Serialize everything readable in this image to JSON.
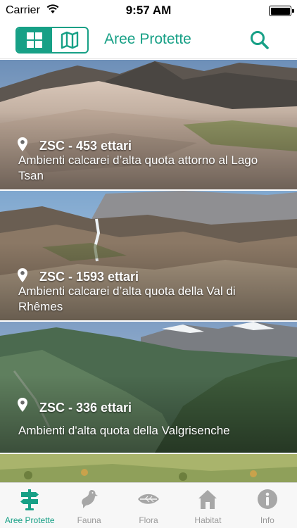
{
  "status_bar": {
    "carrier": "Carrier",
    "time": "9:57 AM"
  },
  "nav": {
    "title": "Aree Protette",
    "view_modes": [
      "grid",
      "map"
    ],
    "active_view": "grid"
  },
  "colors": {
    "accent": "#17a086",
    "tab_inactive": "#9a9a9a"
  },
  "areas": [
    {
      "meta": "ZSC - 453 ettari",
      "description": "Ambienti calcarei d’alta quota attorno al Lago Tsan"
    },
    {
      "meta": "ZSC - 1593 ettari",
      "description": "Ambienti calcarei d’alta quota della Val di Rhêmes"
    },
    {
      "meta": "ZSC - 336 ettari",
      "description": "Ambienti d'alta quota della Valgrisenche"
    }
  ],
  "tabs": [
    {
      "label": "Aree Protette",
      "icon": "signpost-icon",
      "active": true
    },
    {
      "label": "Fauna",
      "icon": "bird-icon",
      "active": false
    },
    {
      "label": "Flora",
      "icon": "leaf-icon",
      "active": false
    },
    {
      "label": "Habitat",
      "icon": "house-icon",
      "active": false
    },
    {
      "label": "Info",
      "icon": "info-icon",
      "active": false
    }
  ]
}
